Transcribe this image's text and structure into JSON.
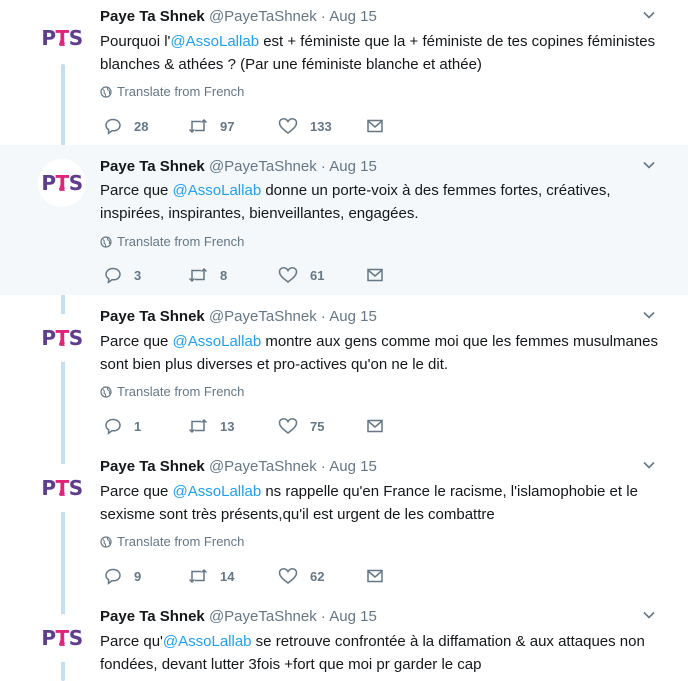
{
  "translate_label": "Translate from French",
  "colors": {
    "mention": "#1da1f2",
    "secondary_text": "#657786",
    "thread_line": "#c4def2",
    "highlight_bg": "#f5f8fa",
    "logo_purple": "#5e3d8f",
    "logo_pink": "#e0247a"
  },
  "avatar_logo": {
    "p": "P",
    "t": "T",
    "s": "S",
    "amp": "&"
  },
  "tweets": [
    {
      "name": "Paye Ta Shnek",
      "handle": "@PayeTaShnek",
      "dot": "·",
      "date": "Aug 15",
      "text_before": "Pourquoi l'",
      "mention": "@AssoLallab",
      "text_after": " est + féministe que la + féministe de tes copines féministes blanches & athées ? (Par une féministe blanche et athée)",
      "replies": "28",
      "retweets": "97",
      "likes": "133"
    },
    {
      "name": "Paye Ta Shnek",
      "handle": "@PayeTaShnek",
      "dot": "·",
      "date": "Aug 15",
      "text_before": "Parce que ",
      "mention": "@AssoLallab",
      "text_after": " donne un porte-voix à des femmes fortes, créatives, inspirées, inspirantes, bienveillantes, engagées.",
      "replies": "3",
      "retweets": "8",
      "likes": "61"
    },
    {
      "name": "Paye Ta Shnek",
      "handle": "@PayeTaShnek",
      "dot": "·",
      "date": "Aug 15",
      "text_before": "Parce que ",
      "mention": "@AssoLallab",
      "text_after": " montre aux gens comme moi que les femmes musulmanes sont bien plus diverses et pro-actives qu'on ne le dit.",
      "replies": "1",
      "retweets": "13",
      "likes": "75"
    },
    {
      "name": "Paye Ta Shnek",
      "handle": "@PayeTaShnek",
      "dot": "·",
      "date": "Aug 15",
      "text_before": "Parce que ",
      "mention": "@AssoLallab",
      "text_after": " ns rappelle qu'en France le racisme, l'islamophobie et le sexisme sont très présents,qu'il est urgent de les combattre",
      "replies": "9",
      "retweets": "14",
      "likes": "62"
    },
    {
      "name": "Paye Ta Shnek",
      "handle": "@PayeTaShnek",
      "dot": "·",
      "date": "Aug 15",
      "text_before": "Parce qu'",
      "mention": "@AssoLallab",
      "text_after": " se retrouve confrontée à la diffamation & aux attaques non fondées, devant lutter 3fois +fort que moi pr garder le cap",
      "replies": "",
      "retweets": "",
      "likes": ""
    }
  ]
}
